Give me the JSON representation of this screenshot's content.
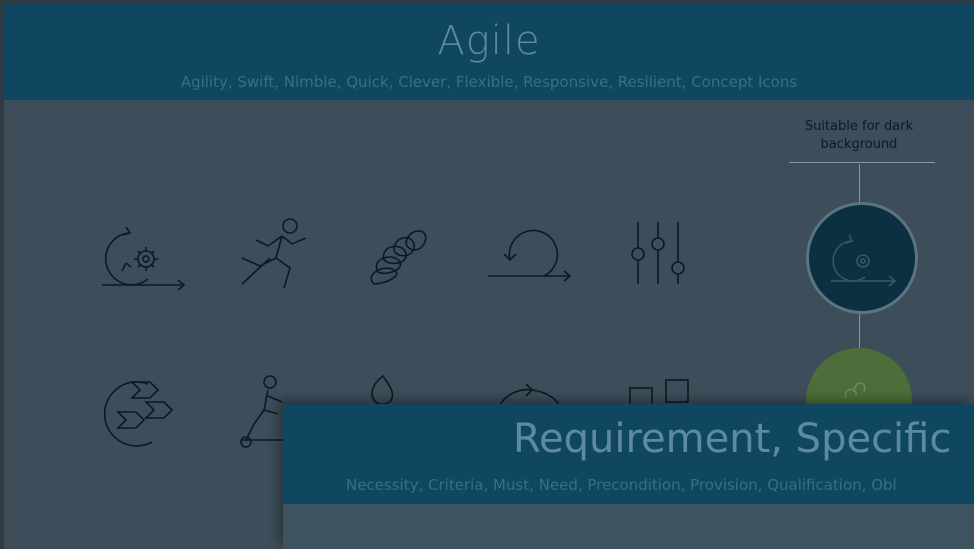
{
  "slide": {
    "title": "Agile",
    "subtitle": "Agility, Swift, Nimble, Quick, Clever, Flexible, Responsive, Resilient, Concept Icons",
    "note": "Suitable for dark background",
    "icons": [
      "agile-cycle-gear-icon",
      "runner-icon",
      "spring-coil-icon",
      "loop-arrow-icon",
      "sliders-icon",
      "circular-arrows-icon",
      "scooter-person-icon",
      "drop-icon",
      "cycle-arrows-icon",
      "blocks-icon"
    ]
  },
  "overlay": {
    "title": "Requirement, Specific",
    "subtitle": "Necessity, Criteria, Must, Need, Precondition, Provision, Qualification, Obl"
  },
  "colors": {
    "header": "#0f4760",
    "background": "#3d4d59",
    "icon_stroke": "#0b1a22",
    "accent_green": "#4d6e3b"
  }
}
